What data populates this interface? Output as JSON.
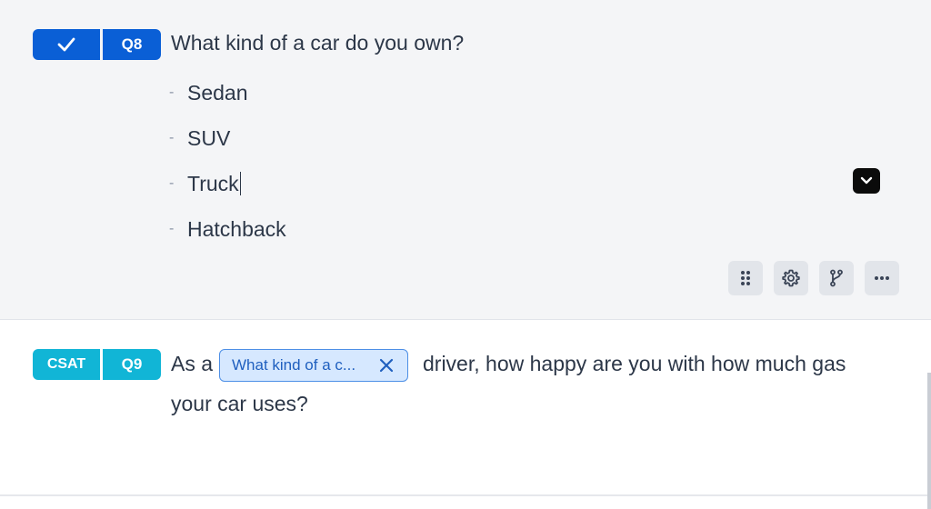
{
  "q8": {
    "type_icon": "check-icon",
    "number": "Q8",
    "title": "What kind of a car do you own?",
    "options": [
      "Sedan",
      "SUV",
      "Truck",
      "Hatchback"
    ],
    "option_bullet": "-",
    "dropdown_icon": "chevron-down-icon",
    "tools": [
      "drag-handle-icon",
      "gear-icon",
      "branch-icon",
      "more-icon"
    ]
  },
  "q9": {
    "type_label": "CSAT",
    "number": "Q9",
    "text_before": "As a",
    "pipe_chip": {
      "label": "What kind of a c...",
      "close_icon": "close-icon"
    },
    "text_after": "driver, how happy are you with how much gas",
    "text_line2": "your car uses?"
  },
  "colors": {
    "q8_badge": "#0a5fd6",
    "q9_badge": "#11b5d6",
    "card_bg": "#f4f5f7",
    "chip_bg": "#d6e8ff",
    "text": "#2c3748"
  }
}
